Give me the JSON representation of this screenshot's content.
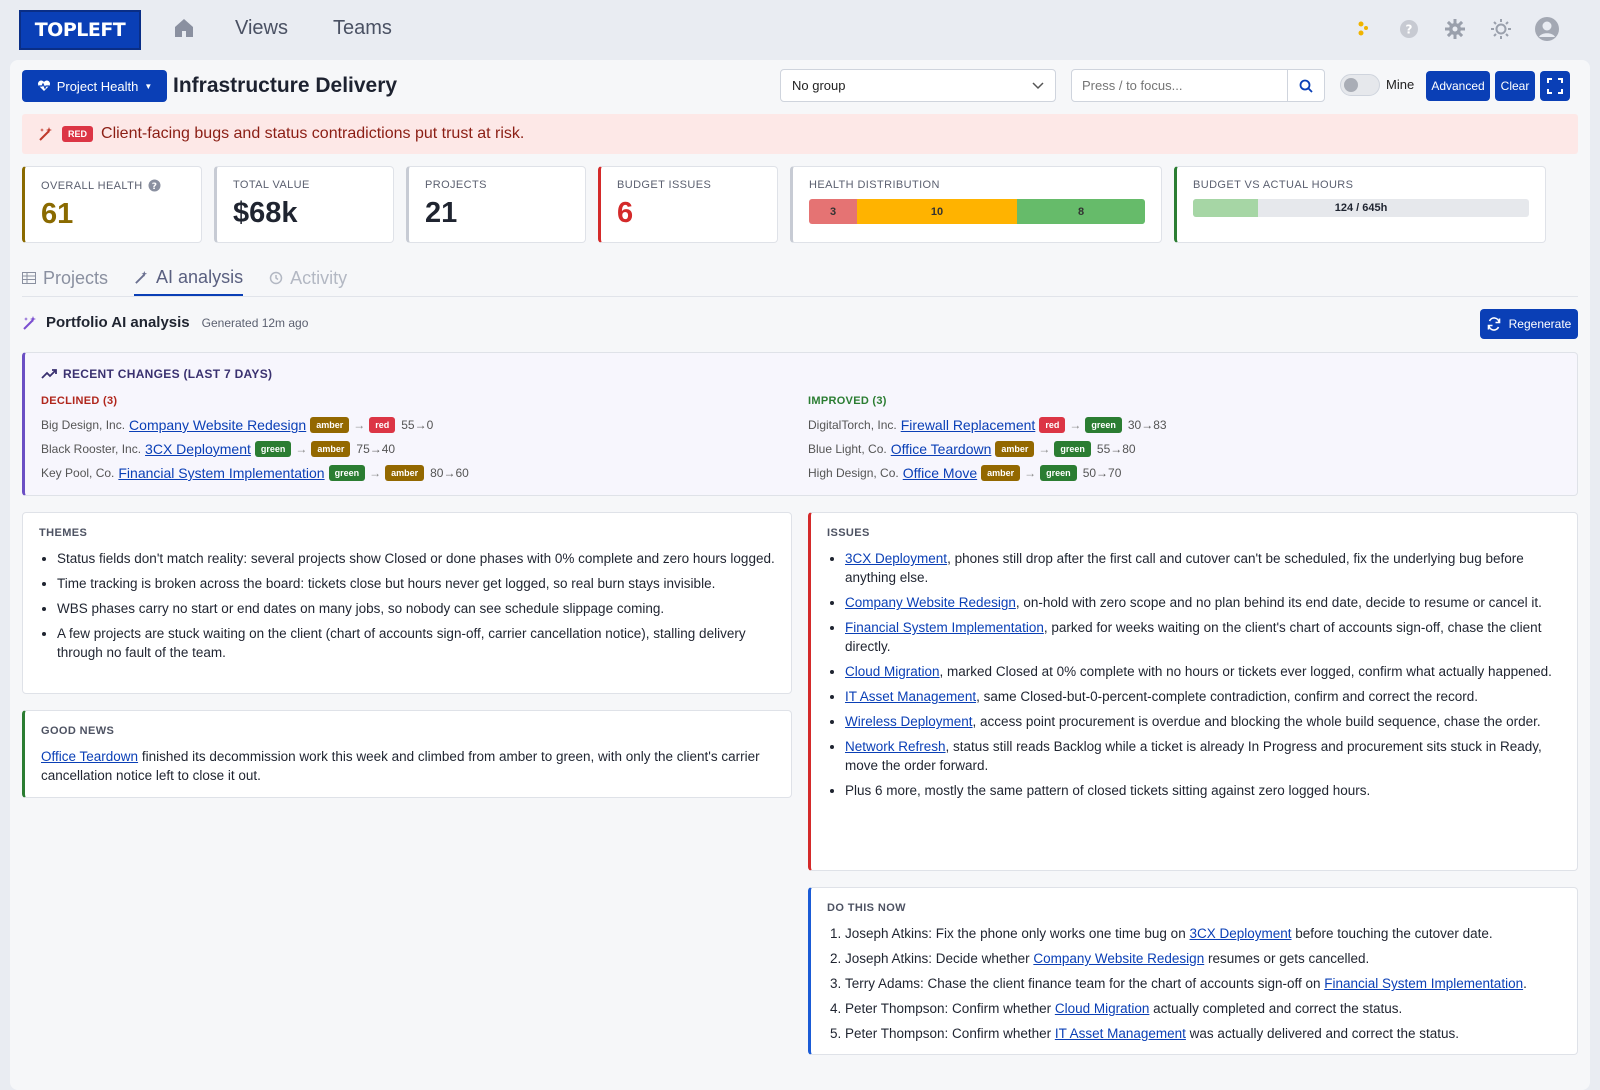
{
  "app": {
    "logo": "TOPLEFT",
    "nav": [
      "Views",
      "Teams"
    ]
  },
  "toolbar": {
    "project_health_label": "Project Health",
    "title": "Infrastructure Delivery",
    "group_select": "No group",
    "search_placeholder": "Press / to focus...",
    "mine_label": "Mine",
    "advanced_label": "Advanced",
    "clear_label": "Clear"
  },
  "alert": {
    "badge": "RED",
    "text": "Client-facing bugs and status contradictions put trust at risk."
  },
  "kpis": {
    "overall_health": {
      "label": "OVERALL HEALTH",
      "value": "61",
      "color": "#8a6a00"
    },
    "total_value": {
      "label": "TOTAL VALUE",
      "value": "$68k"
    },
    "projects": {
      "label": "PROJECTS",
      "value": "21"
    },
    "budget_issues": {
      "label": "BUDGET ISSUES",
      "value": "6",
      "color": "#d42a2a"
    },
    "health_distribution": {
      "label": "HEALTH DISTRIBUTION",
      "red": 3,
      "amber": 10,
      "green": 8
    },
    "budget_vs_actual": {
      "label": "BUDGET VS ACTUAL HOURS",
      "text": "124 / 645h",
      "actual": 124,
      "budget": 645
    }
  },
  "tabs": [
    "Projects",
    "AI analysis",
    "Activity"
  ],
  "analysis": {
    "title": "Portfolio AI analysis",
    "generated": "Generated 12m ago",
    "regenerate_label": "Regenerate"
  },
  "recent_changes": {
    "title": "RECENT CHANGES (LAST 7 DAYS)",
    "declined_label": "DECLINED (3)",
    "improved_label": "IMPROVED (3)",
    "declined": [
      {
        "client": "Big Design, Inc.",
        "project": "Company Website Redesign",
        "from": "amber",
        "to": "red",
        "score": "55→0"
      },
      {
        "client": "Black Rooster, Inc.",
        "project": "3CX Deployment",
        "from": "green",
        "to": "amber",
        "score": "75→40"
      },
      {
        "client": "Key Pool, Co.",
        "project": "Financial System Implementation",
        "from": "green",
        "to": "amber",
        "score": "80→60"
      }
    ],
    "improved": [
      {
        "client": "DigitalTorch, Inc.",
        "project": "Firewall Replacement",
        "from": "red",
        "to": "green",
        "score": "30→83"
      },
      {
        "client": "Blue Light, Co.",
        "project": "Office Teardown",
        "from": "amber",
        "to": "green",
        "score": "55→80"
      },
      {
        "client": "High Design, Co.",
        "project": "Office Move",
        "from": "amber",
        "to": "green",
        "score": "50→70"
      }
    ]
  },
  "themes": {
    "title": "THEMES",
    "items": [
      "Status fields don't match reality: several projects show Closed or done phases with 0% complete and zero hours logged.",
      "Time tracking is broken across the board: tickets close but hours never get logged, so real burn stays invisible.",
      "WBS phases carry no start or end dates on many jobs, so nobody can see schedule slippage coming.",
      "A few projects are stuck waiting on the client (chart of accounts sign-off, carrier cancellation notice), stalling delivery through no fault of the team."
    ]
  },
  "good_news": {
    "title": "GOOD NEWS",
    "link": "Office Teardown",
    "text": " finished its decommission work this week and climbed from amber to green, with only the client's carrier cancellation notice left to close it out."
  },
  "issues": {
    "title": "ISSUES",
    "items": [
      {
        "link": "3CX Deployment",
        "text": ", phones still drop after the first call and cutover can't be scheduled, fix the underlying bug before anything else."
      },
      {
        "link": "Company Website Redesign",
        "text": ", on-hold with zero scope and no plan behind its end date, decide to resume or cancel it."
      },
      {
        "link": "Financial System Implementation",
        "text": ", parked for weeks waiting on the client's chart of accounts sign-off, chase the client directly."
      },
      {
        "link": "Cloud Migration",
        "text": ", marked Closed at 0% complete with no hours or tickets ever logged, confirm what actually happened."
      },
      {
        "link": "IT Asset Management",
        "text": ", same Closed-but-0-percent-complete contradiction, confirm and correct the record."
      },
      {
        "link": "Wireless Deployment",
        "text": ", access point procurement is overdue and blocking the whole build sequence, chase the order."
      },
      {
        "link": "Network Refresh",
        "text": ", status still reads Backlog while a ticket is already In Progress and procurement sits stuck in Ready, move the order forward."
      },
      {
        "link": "",
        "text": "Plus 6 more, mostly the same pattern of closed tickets sitting against zero logged hours."
      }
    ]
  },
  "do_this_now": {
    "title": "DO THIS NOW",
    "items": [
      {
        "pre": "Joseph Atkins: Fix the phone only works one time bug on ",
        "link": "3CX Deployment",
        "post": " before touching the cutover date."
      },
      {
        "pre": "Joseph Atkins: Decide whether ",
        "link": "Company Website Redesign",
        "post": " resumes or gets cancelled."
      },
      {
        "pre": "Terry Adams: Chase the client finance team for the chart of accounts sign-off on ",
        "link": "Financial System Implementation",
        "post": "."
      },
      {
        "pre": "Peter Thompson: Confirm whether ",
        "link": "Cloud Migration",
        "post": " actually completed and correct the status."
      },
      {
        "pre": "Peter Thompson: Confirm whether ",
        "link": "IT Asset Management",
        "post": " was actually delivered and correct the status."
      }
    ]
  },
  "colors": {
    "primary": "#0a3fb6",
    "red": "#dc3545",
    "amber": "#936800",
    "green": "#2b7d32",
    "bar_red": "#e57373",
    "bar_amber": "#ffb300",
    "bar_green": "#66bb6a"
  }
}
